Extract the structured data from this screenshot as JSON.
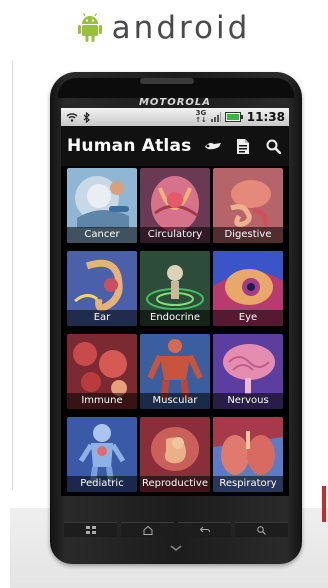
{
  "brand": {
    "logo_icon": "android-robot-icon",
    "wordmark": "android",
    "accent": "#97C03D"
  },
  "device": {
    "maker": "MOTOROLA"
  },
  "status_bar": {
    "icons": [
      "wifi-icon",
      "bluetooth-icon",
      "signal-icon",
      "battery-icon"
    ],
    "network_top": "3G",
    "network_bottom": "↑↓",
    "time": "11:38"
  },
  "app": {
    "title": "Human Atlas",
    "actions": [
      "bookmark-icon",
      "document-icon",
      "search-icon"
    ]
  },
  "tiles": [
    {
      "label": "Cancer"
    },
    {
      "label": "Circulatory"
    },
    {
      "label": "Digestive"
    },
    {
      "label": "Ear"
    },
    {
      "label": "Endocrine"
    },
    {
      "label": "Eye"
    },
    {
      "label": "Immune"
    },
    {
      "label": "Muscular"
    },
    {
      "label": "Nervous"
    },
    {
      "label": "Pediatric"
    },
    {
      "label": "Reproductive"
    },
    {
      "label": "Respiratory"
    }
  ],
  "hardware_keys": [
    "menu-icon",
    "home-icon",
    "back-icon",
    "search-icon"
  ]
}
